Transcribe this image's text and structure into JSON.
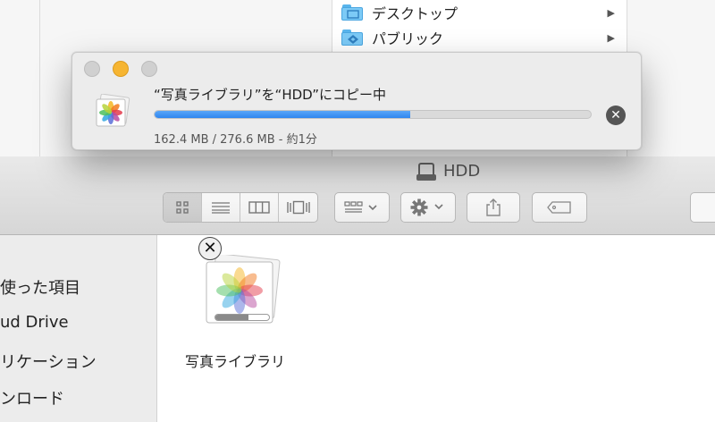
{
  "background_columns": {
    "items": [
      {
        "label": "デスクトップ",
        "icon": "desktop-folder-icon"
      },
      {
        "label": "パブリック",
        "icon": "public-folder-icon"
      }
    ]
  },
  "copy_dialog": {
    "title": "“写真ライブラリ”を“HDD”にコピー中",
    "progress": 0.587,
    "status": "162.4 MB / 276.6 MB - 約1分",
    "stop_icon": "stop-circle-x-icon",
    "file_icon": "photos-library-icon"
  },
  "finder": {
    "title": "HDD",
    "title_icon": "external-drive-icon",
    "toolbar": {
      "view_modes": [
        "icon-view",
        "list-view",
        "column-view",
        "cover-flow-view"
      ],
      "active_view": "icon-view",
      "arrange_icon": "arrange-grid-icon",
      "action_icon": "gear-icon",
      "share_icon": "share-icon",
      "tag_icon": "tag-icon"
    },
    "sidebar": {
      "items": [
        {
          "label": "使った項目"
        },
        {
          "label": "ud Drive"
        },
        {
          "label": "リケーション"
        },
        {
          "label": "ンロード"
        }
      ]
    },
    "content": {
      "items": [
        {
          "label": "写真ライブラリ",
          "icon": "photos-library-icon",
          "copy_progress": 0.62
        }
      ]
    }
  },
  "colors": {
    "progress_blue": "#3b8ff3",
    "minimize_yellow": "#f6b532",
    "folder_blue": "#7ccaf6"
  }
}
